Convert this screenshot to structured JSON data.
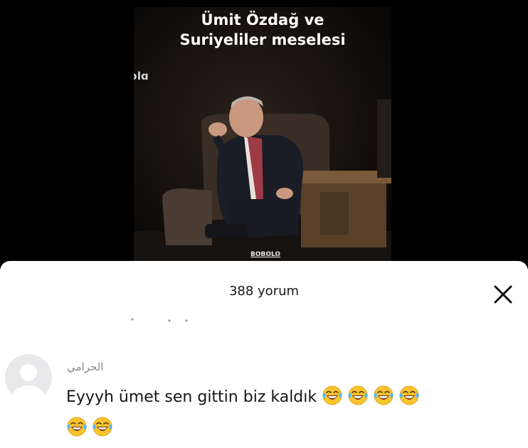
{
  "video": {
    "title_line1": "Ümit Özdağ ve",
    "title_line2": "Suriyeliler meselesi",
    "logo_corner": "ɔlɑ",
    "logo_bottom": "BOBOLO"
  },
  "comments_sheet": {
    "count_label": "388 yorum",
    "close_icon": "close-icon"
  },
  "comment": {
    "username": "الحرامي",
    "text": "Eyyyh ümet sen gittin biz kaldık",
    "emoji_icon": "face-with-tears-of-joy-icon",
    "emoji_count": 6
  }
}
